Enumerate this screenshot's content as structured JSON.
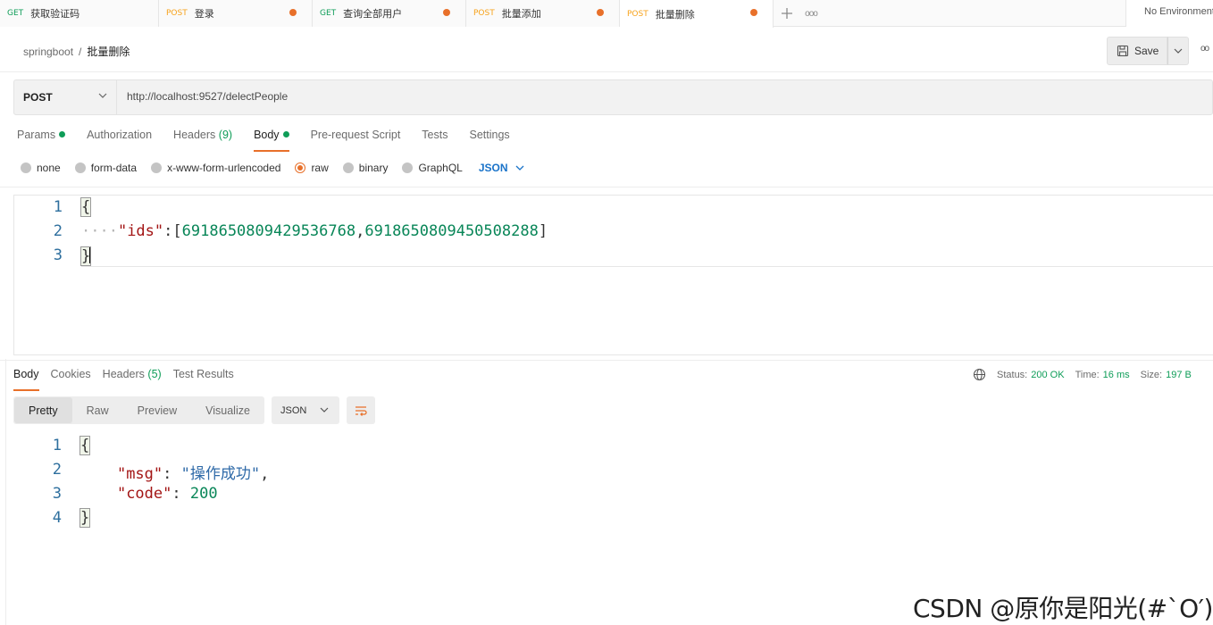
{
  "tabs": [
    {
      "method": "GET",
      "name": "获取验证码",
      "unsaved": false,
      "active": false
    },
    {
      "method": "POST",
      "name": "登录",
      "unsaved": true,
      "active": false
    },
    {
      "method": "GET",
      "name": "查询全部用户",
      "unsaved": true,
      "active": false
    },
    {
      "method": "POST",
      "name": "批量添加",
      "unsaved": true,
      "active": false
    },
    {
      "method": "POST",
      "name": "批量删除",
      "unsaved": true,
      "active": true
    }
  ],
  "tabbar": {
    "more": "ooo"
  },
  "environment": "No Environment",
  "breadcrumb": {
    "collection": "springboot",
    "separator": "/",
    "request": "批量删除"
  },
  "toolbar": {
    "save_label": "Save",
    "more": "oo"
  },
  "request": {
    "method": "POST",
    "url": "http://localhost:9527/delectPeople",
    "tabs": [
      {
        "label": "Params",
        "dot": true
      },
      {
        "label": "Authorization"
      },
      {
        "label": "Headers",
        "count": "(9)"
      },
      {
        "label": "Body",
        "dot": true,
        "active": true
      },
      {
        "label": "Pre-request Script"
      },
      {
        "label": "Tests"
      },
      {
        "label": "Settings"
      }
    ],
    "body_types": [
      "none",
      "form-data",
      "x-www-form-urlencoded",
      "raw",
      "binary",
      "GraphQL"
    ],
    "selected_body_type": "raw",
    "language": "JSON",
    "body_lines": {
      "l1": "1",
      "l2": "2",
      "l3": "3",
      "open": "{",
      "close": "}",
      "indent": "····",
      "key": "\"ids\"",
      "colon": ":",
      "lbracket": "[",
      "id1": "6918650809429536768",
      "comma": ",",
      "id2": "6918650809450508288",
      "rbracket": "]"
    }
  },
  "response": {
    "tabs": [
      {
        "label": "Body",
        "active": true
      },
      {
        "label": "Cookies"
      },
      {
        "label": "Headers",
        "count": "(5)"
      },
      {
        "label": "Test Results"
      }
    ],
    "status_label": "Status:",
    "status": "200 OK",
    "time_label": "Time:",
    "time": "16 ms",
    "size_label": "Size:",
    "size": "197 B",
    "views": [
      "Pretty",
      "Raw",
      "Preview",
      "Visualize"
    ],
    "active_view": "Pretty",
    "format": "JSON",
    "body_lines": {
      "l1": "1",
      "l2": "2",
      "l3": "3",
      "l4": "4",
      "open": "{",
      "close": "}",
      "key1": "\"msg\"",
      "val1": "\"操作成功\"",
      "key2": "\"code\"",
      "val2": "200"
    }
  },
  "watermark": "CSDN @原你是阳光(#`O′)",
  "colors": {
    "accent": "#e8702a",
    "success": "#0f9d58",
    "link": "#1a73c9"
  }
}
